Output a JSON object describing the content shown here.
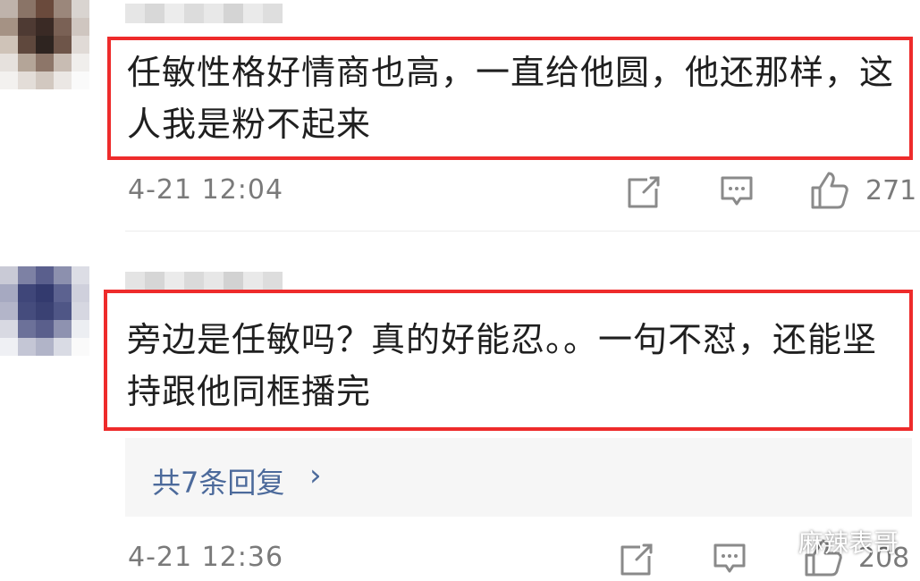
{
  "comments": [
    {
      "text_line1": "任敏性格好情商也高，一直给他圆，他还那样，这",
      "text_line2": "人我是粉不起来",
      "time": "4-21 12:04",
      "likes": "271"
    },
    {
      "text_line1": "旁边是任敏吗？真的好能忍。。一句不怼，还能坚",
      "text_line2": "持跟他同框播完",
      "time": "4-21 12:36",
      "likes": "208"
    }
  ],
  "replies": {
    "label": "共7条回复",
    "chevron": "›"
  },
  "watermark": {
    "text": "麻辣表哥"
  },
  "icons": {
    "share": "share-icon",
    "reply": "comment-icon",
    "like": "thumbs-up-icon",
    "wechat": "wechat-icon"
  },
  "colors": {
    "highlight": "#ee2b2b",
    "link": "#4c6a9b",
    "meta": "#7a7a7a"
  }
}
